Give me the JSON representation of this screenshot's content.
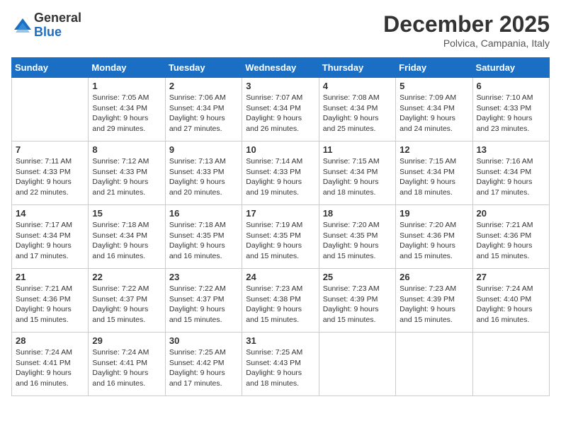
{
  "logo": {
    "general": "General",
    "blue": "Blue"
  },
  "header": {
    "month": "December 2025",
    "location": "Polvica, Campania, Italy"
  },
  "weekdays": [
    "Sunday",
    "Monday",
    "Tuesday",
    "Wednesday",
    "Thursday",
    "Friday",
    "Saturday"
  ],
  "weeks": [
    [
      null,
      {
        "day": 1,
        "sunrise": "7:05 AM",
        "sunset": "4:34 PM",
        "daylight": "9 hours and 29 minutes."
      },
      {
        "day": 2,
        "sunrise": "7:06 AM",
        "sunset": "4:34 PM",
        "daylight": "9 hours and 27 minutes."
      },
      {
        "day": 3,
        "sunrise": "7:07 AM",
        "sunset": "4:34 PM",
        "daylight": "9 hours and 26 minutes."
      },
      {
        "day": 4,
        "sunrise": "7:08 AM",
        "sunset": "4:34 PM",
        "daylight": "9 hours and 25 minutes."
      },
      {
        "day": 5,
        "sunrise": "7:09 AM",
        "sunset": "4:34 PM",
        "daylight": "9 hours and 24 minutes."
      },
      {
        "day": 6,
        "sunrise": "7:10 AM",
        "sunset": "4:33 PM",
        "daylight": "9 hours and 23 minutes."
      }
    ],
    [
      {
        "day": 7,
        "sunrise": "7:11 AM",
        "sunset": "4:33 PM",
        "daylight": "9 hours and 22 minutes."
      },
      {
        "day": 8,
        "sunrise": "7:12 AM",
        "sunset": "4:33 PM",
        "daylight": "9 hours and 21 minutes."
      },
      {
        "day": 9,
        "sunrise": "7:13 AM",
        "sunset": "4:33 PM",
        "daylight": "9 hours and 20 minutes."
      },
      {
        "day": 10,
        "sunrise": "7:14 AM",
        "sunset": "4:33 PM",
        "daylight": "9 hours and 19 minutes."
      },
      {
        "day": 11,
        "sunrise": "7:15 AM",
        "sunset": "4:34 PM",
        "daylight": "9 hours and 18 minutes."
      },
      {
        "day": 12,
        "sunrise": "7:15 AM",
        "sunset": "4:34 PM",
        "daylight": "9 hours and 18 minutes."
      },
      {
        "day": 13,
        "sunrise": "7:16 AM",
        "sunset": "4:34 PM",
        "daylight": "9 hours and 17 minutes."
      }
    ],
    [
      {
        "day": 14,
        "sunrise": "7:17 AM",
        "sunset": "4:34 PM",
        "daylight": "9 hours and 17 minutes."
      },
      {
        "day": 15,
        "sunrise": "7:18 AM",
        "sunset": "4:34 PM",
        "daylight": "9 hours and 16 minutes."
      },
      {
        "day": 16,
        "sunrise": "7:18 AM",
        "sunset": "4:35 PM",
        "daylight": "9 hours and 16 minutes."
      },
      {
        "day": 17,
        "sunrise": "7:19 AM",
        "sunset": "4:35 PM",
        "daylight": "9 hours and 15 minutes."
      },
      {
        "day": 18,
        "sunrise": "7:20 AM",
        "sunset": "4:35 PM",
        "daylight": "9 hours and 15 minutes."
      },
      {
        "day": 19,
        "sunrise": "7:20 AM",
        "sunset": "4:36 PM",
        "daylight": "9 hours and 15 minutes."
      },
      {
        "day": 20,
        "sunrise": "7:21 AM",
        "sunset": "4:36 PM",
        "daylight": "9 hours and 15 minutes."
      }
    ],
    [
      {
        "day": 21,
        "sunrise": "7:21 AM",
        "sunset": "4:36 PM",
        "daylight": "9 hours and 15 minutes."
      },
      {
        "day": 22,
        "sunrise": "7:22 AM",
        "sunset": "4:37 PM",
        "daylight": "9 hours and 15 minutes."
      },
      {
        "day": 23,
        "sunrise": "7:22 AM",
        "sunset": "4:37 PM",
        "daylight": "9 hours and 15 minutes."
      },
      {
        "day": 24,
        "sunrise": "7:23 AM",
        "sunset": "4:38 PM",
        "daylight": "9 hours and 15 minutes."
      },
      {
        "day": 25,
        "sunrise": "7:23 AM",
        "sunset": "4:39 PM",
        "daylight": "9 hours and 15 minutes."
      },
      {
        "day": 26,
        "sunrise": "7:23 AM",
        "sunset": "4:39 PM",
        "daylight": "9 hours and 15 minutes."
      },
      {
        "day": 27,
        "sunrise": "7:24 AM",
        "sunset": "4:40 PM",
        "daylight": "9 hours and 16 minutes."
      }
    ],
    [
      {
        "day": 28,
        "sunrise": "7:24 AM",
        "sunset": "4:41 PM",
        "daylight": "9 hours and 16 minutes."
      },
      {
        "day": 29,
        "sunrise": "7:24 AM",
        "sunset": "4:41 PM",
        "daylight": "9 hours and 16 minutes."
      },
      {
        "day": 30,
        "sunrise": "7:25 AM",
        "sunset": "4:42 PM",
        "daylight": "9 hours and 17 minutes."
      },
      {
        "day": 31,
        "sunrise": "7:25 AM",
        "sunset": "4:43 PM",
        "daylight": "9 hours and 18 minutes."
      },
      null,
      null,
      null
    ]
  ]
}
